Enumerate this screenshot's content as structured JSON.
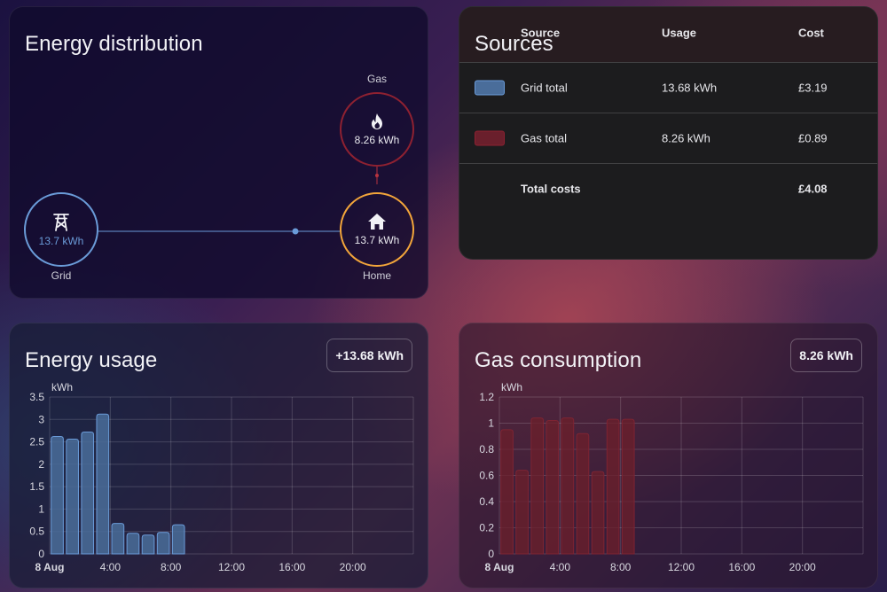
{
  "colors": {
    "grid": "#6a9bd8",
    "gas": "#8e2131",
    "gas_ring": "#b8333f",
    "home": "#f2a53a",
    "grid_bar": "#4a6d9a",
    "gas_bar": "#6a1f2c"
  },
  "distribution": {
    "title": "Energy distribution",
    "grid": {
      "label": "Grid",
      "value": "13.7 kWh",
      "icon": "transmission-tower-icon"
    },
    "gas": {
      "label": "Gas",
      "value": "8.26 kWh",
      "icon": "fire-icon"
    },
    "home": {
      "label": "Home",
      "value": "13.7 kWh",
      "icon": "home-icon"
    }
  },
  "sources": {
    "title": "Sources",
    "headers": {
      "source": "Source",
      "usage": "Usage",
      "cost": "Cost"
    },
    "rows": [
      {
        "source": "Grid total",
        "usage": "13.68 kWh",
        "cost": "£3.19",
        "swatch": "grid"
      },
      {
        "source": "Gas total",
        "usage": "8.26 kWh",
        "cost": "£0.89",
        "swatch": "gas"
      }
    ],
    "total": {
      "label": "Total costs",
      "cost": "£4.08"
    }
  },
  "usage": {
    "title": "Energy usage",
    "badge": "+13.68 kWh",
    "chart_data": {
      "type": "bar",
      "ylabel": "kWh",
      "ylim": [
        0,
        3.5
      ],
      "yticks": [
        "0",
        "0.5",
        "1",
        "1.5",
        "2",
        "2.5",
        "3",
        "3.5"
      ],
      "yvals": [
        0,
        0.5,
        1,
        1.5,
        2,
        2.5,
        3,
        3.5
      ],
      "xticks": [
        "8 Aug",
        "4:00",
        "8:00",
        "12:00",
        "16:00",
        "20:00"
      ],
      "xhours": [
        0,
        4,
        8,
        12,
        16,
        20
      ],
      "xlim_hours": [
        0,
        24
      ],
      "hours": [
        1,
        2,
        3,
        4,
        5,
        6,
        7,
        8,
        9
      ],
      "values": [
        2.62,
        2.56,
        2.72,
        3.12,
        0.68,
        0.46,
        0.42,
        0.48,
        0.65
      ]
    }
  },
  "gas_chart": {
    "title": "Gas consumption",
    "badge": "8.26 kWh",
    "chart_data": {
      "type": "bar",
      "ylabel": "kWh",
      "ylim": [
        0,
        1.2
      ],
      "yticks": [
        "0",
        "0.2",
        "0.4",
        "0.6",
        "0.8",
        "1",
        "1.2"
      ],
      "yvals": [
        0,
        0.2,
        0.4,
        0.6,
        0.8,
        1,
        1.2
      ],
      "xticks": [
        "8 Aug",
        "4:00",
        "8:00",
        "12:00",
        "16:00",
        "20:00"
      ],
      "xhours": [
        0,
        4,
        8,
        12,
        16,
        20
      ],
      "xlim_hours": [
        0,
        24
      ],
      "hours": [
        1,
        2,
        3,
        4,
        5,
        6,
        7,
        8,
        9
      ],
      "values": [
        0.95,
        0.64,
        1.04,
        1.02,
        1.04,
        0.92,
        0.63,
        1.03,
        1.03
      ]
    }
  }
}
